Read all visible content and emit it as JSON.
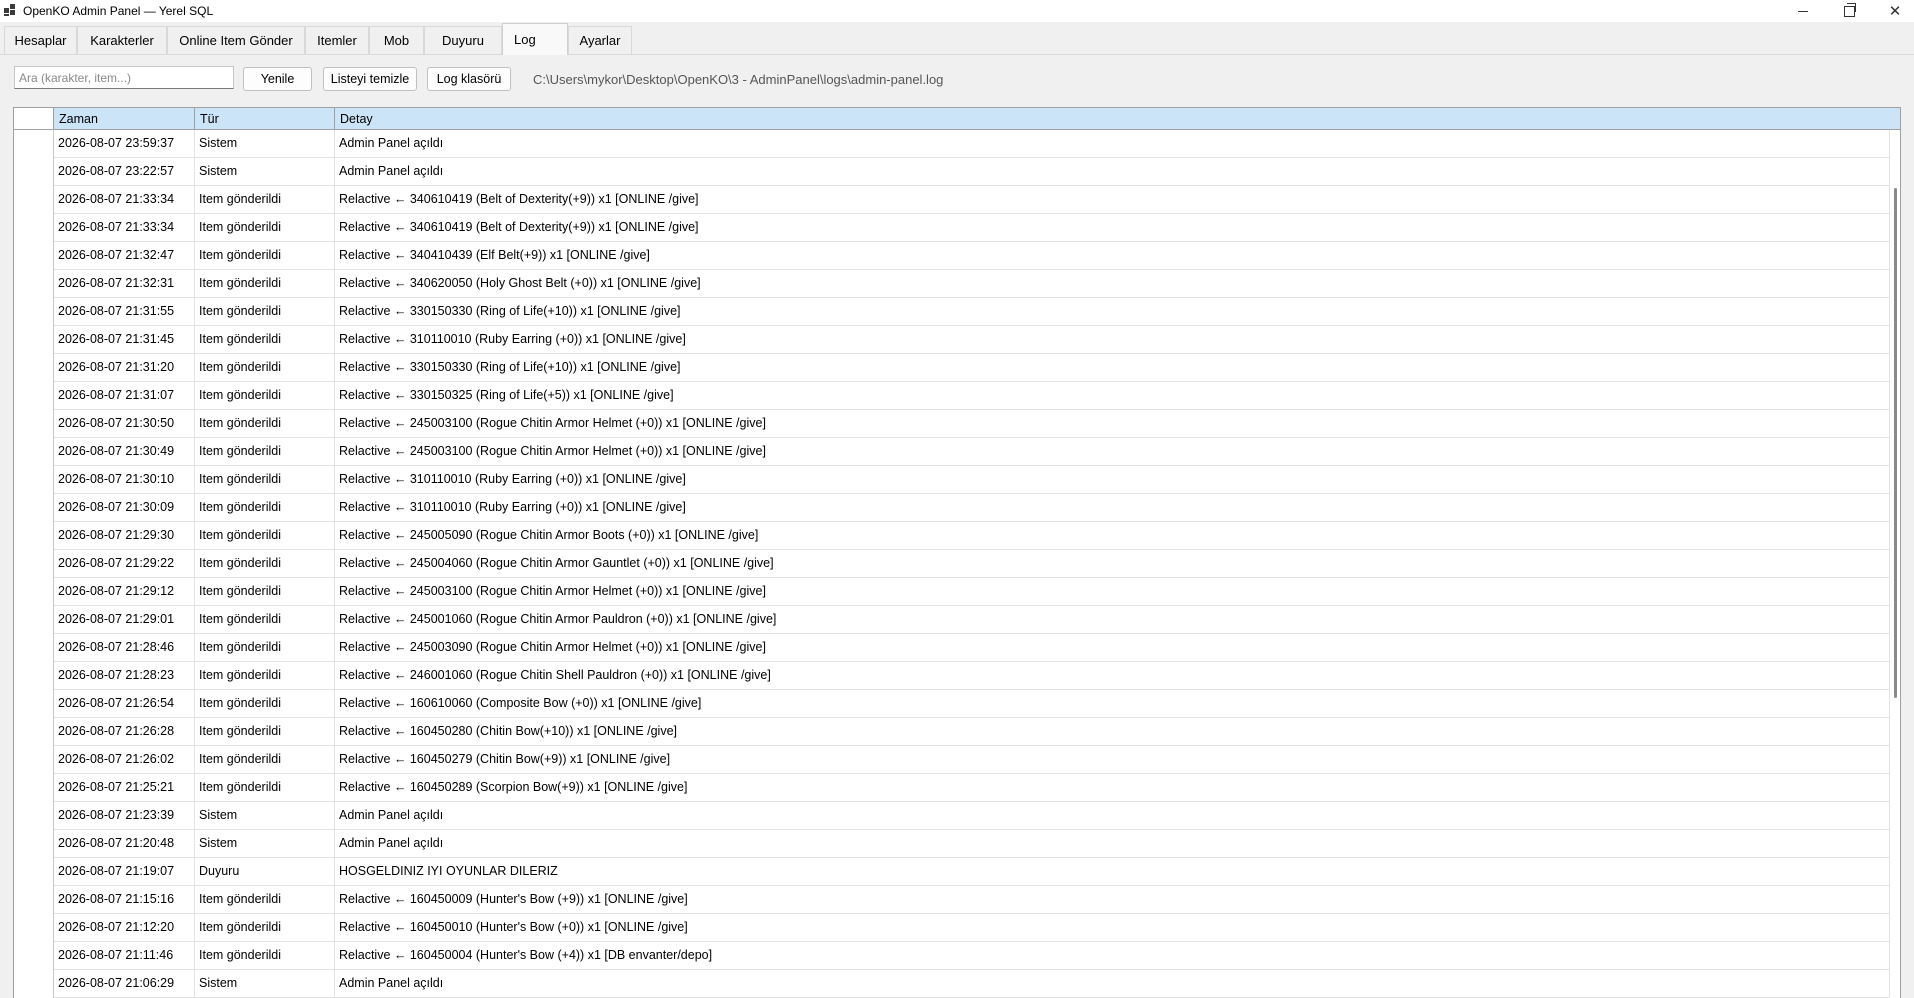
{
  "window": {
    "title": "OpenKO Admin Panel — Yerel SQL",
    "minimize_icon": "minimize-icon",
    "maximize_icon": "restore-icon",
    "close_icon": "close-icon",
    "close_glyph": "✕"
  },
  "tabs": [
    {
      "label": "Hesaplar"
    },
    {
      "label": "Karakterler"
    },
    {
      "label": "Online Item Gönder"
    },
    {
      "label": "Itemler"
    },
    {
      "label": "Mob"
    },
    {
      "label": "Duyuru"
    },
    {
      "label": "Log",
      "active": true
    },
    {
      "label": "Ayarlar"
    }
  ],
  "toolbar": {
    "search_placeholder": "Ara (karakter, item...)",
    "search_value": "",
    "refresh_label": "Yenile",
    "clear_label": "Listeyi temizle",
    "folder_label": "Log klasörü",
    "log_path": "C:\\Users\\mykor\\Desktop\\OpenKO\\3 - AdminPanel\\logs\\admin-panel.log"
  },
  "table": {
    "columns": [
      "Zaman",
      "Tür",
      "Detay"
    ],
    "rows": [
      [
        "2026-08-07 23:59:37",
        "Sistem",
        "Admin Panel açıldı"
      ],
      [
        "2026-08-07 23:22:57",
        "Sistem",
        "Admin Panel açıldı"
      ],
      [
        "2026-08-07 21:33:34",
        "Item gönderildi",
        "Relactive ← 340610419 (Belt of Dexterity(+9)) x1  [ONLINE /give]"
      ],
      [
        "2026-08-07 21:33:34",
        "Item gönderildi",
        "Relactive ← 340610419 (Belt of Dexterity(+9)) x1  [ONLINE /give]"
      ],
      [
        "2026-08-07 21:32:47",
        "Item gönderildi",
        "Relactive ← 340410439 (Elf Belt(+9)) x1  [ONLINE /give]"
      ],
      [
        "2026-08-07 21:32:31",
        "Item gönderildi",
        "Relactive ← 340620050 (Holy Ghost Belt (+0)) x1  [ONLINE /give]"
      ],
      [
        "2026-08-07 21:31:55",
        "Item gönderildi",
        "Relactive ← 330150330 (Ring of Life(+10)) x1  [ONLINE /give]"
      ],
      [
        "2026-08-07 21:31:45",
        "Item gönderildi",
        "Relactive ← 310110010 (Ruby Earring (+0)) x1  [ONLINE /give]"
      ],
      [
        "2026-08-07 21:31:20",
        "Item gönderildi",
        "Relactive ← 330150330 (Ring of Life(+10)) x1  [ONLINE /give]"
      ],
      [
        "2026-08-07 21:31:07",
        "Item gönderildi",
        "Relactive ← 330150325 (Ring of Life(+5)) x1  [ONLINE /give]"
      ],
      [
        "2026-08-07 21:30:50",
        "Item gönderildi",
        "Relactive ← 245003100 (Rogue Chitin Armor Helmet (+0)) x1  [ONLINE /give]"
      ],
      [
        "2026-08-07 21:30:49",
        "Item gönderildi",
        "Relactive ← 245003100 (Rogue Chitin Armor Helmet (+0)) x1  [ONLINE /give]"
      ],
      [
        "2026-08-07 21:30:10",
        "Item gönderildi",
        "Relactive ← 310110010 (Ruby Earring (+0)) x1  [ONLINE /give]"
      ],
      [
        "2026-08-07 21:30:09",
        "Item gönderildi",
        "Relactive ← 310110010 (Ruby Earring (+0)) x1  [ONLINE /give]"
      ],
      [
        "2026-08-07 21:29:30",
        "Item gönderildi",
        "Relactive ← 245005090 (Rogue Chitin Armor Boots (+0)) x1  [ONLINE /give]"
      ],
      [
        "2026-08-07 21:29:22",
        "Item gönderildi",
        "Relactive ← 245004060 (Rogue Chitin Armor Gauntlet (+0)) x1  [ONLINE /give]"
      ],
      [
        "2026-08-07 21:29:12",
        "Item gönderildi",
        "Relactive ← 245003100 (Rogue Chitin Armor Helmet (+0)) x1  [ONLINE /give]"
      ],
      [
        "2026-08-07 21:29:01",
        "Item gönderildi",
        "Relactive ← 245001060 (Rogue Chitin Armor Pauldron (+0)) x1  [ONLINE /give]"
      ],
      [
        "2026-08-07 21:28:46",
        "Item gönderildi",
        "Relactive ← 245003090 (Rogue Chitin Armor Helmet (+0)) x1  [ONLINE /give]"
      ],
      [
        "2026-08-07 21:28:23",
        "Item gönderildi",
        "Relactive ← 246001060 (Rogue Chitin Shell Pauldron (+0)) x1  [ONLINE /give]"
      ],
      [
        "2026-08-07 21:26:54",
        "Item gönderildi",
        "Relactive ← 160610060 (Composite Bow (+0)) x1  [ONLINE /give]"
      ],
      [
        "2026-08-07 21:26:28",
        "Item gönderildi",
        "Relactive ← 160450280 (Chitin Bow(+10)) x1  [ONLINE /give]"
      ],
      [
        "2026-08-07 21:26:02",
        "Item gönderildi",
        "Relactive ← 160450279 (Chitin Bow(+9)) x1  [ONLINE /give]"
      ],
      [
        "2026-08-07 21:25:21",
        "Item gönderildi",
        "Relactive ← 160450289 (Scorpion Bow(+9)) x1  [ONLINE /give]"
      ],
      [
        "2026-08-07 21:23:39",
        "Sistem",
        "Admin Panel açıldı"
      ],
      [
        "2026-08-07 21:20:48",
        "Sistem",
        "Admin Panel açıldı"
      ],
      [
        "2026-08-07 21:19:07",
        "Duyuru",
        "HOSGELDINIZ IYI OYUNLAR DILERIZ"
      ],
      [
        "2026-08-07 21:15:16",
        "Item gönderildi",
        "Relactive ← 160450009 (Hunter's Bow (+9)) x1  [ONLINE /give]"
      ],
      [
        "2026-08-07 21:12:20",
        "Item gönderildi",
        "Relactive ← 160450010 (Hunter's Bow (+0)) x1  [ONLINE /give]"
      ],
      [
        "2026-08-07 21:11:46",
        "Item gönderildi",
        "Relactive ← 160450004 (Hunter's Bow (+4)) x1  [DB envanter/depo]"
      ],
      [
        "2026-08-07 21:06:29",
        "Sistem",
        "Admin Panel açıldı"
      ]
    ]
  }
}
